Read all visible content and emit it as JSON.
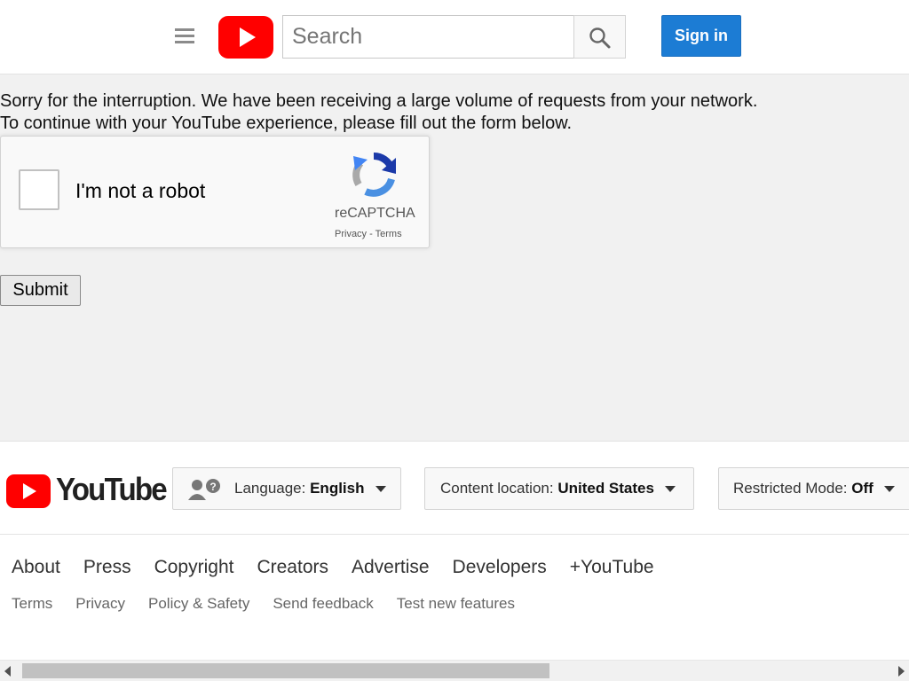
{
  "header": {
    "search_placeholder": "Search",
    "sign_in_label": "Sign in",
    "brand_color": "#ff0000",
    "accent_color": "#1c7cd4"
  },
  "message": {
    "line1": "Sorry for the interruption. We have been receiving a large volume of requests from your network.",
    "line2": "To continue with your YouTube experience, please fill out the form below."
  },
  "recaptcha": {
    "label": "I'm not a robot",
    "brand": "reCAPTCHA",
    "privacy": "Privacy",
    "separator": " - ",
    "terms": "Terms"
  },
  "form": {
    "submit_label": "Submit"
  },
  "footer": {
    "logo_text": "YouTube",
    "language": {
      "label": "Language: ",
      "value": "English"
    },
    "location": {
      "label": "Content location: ",
      "value": "United States"
    },
    "restricted": {
      "label": "Restricted Mode: ",
      "value": "Off"
    },
    "primary_links": [
      "About",
      "Press",
      "Copyright",
      "Creators",
      "Advertise",
      "Developers",
      "+YouTube"
    ],
    "secondary_links": [
      "Terms",
      "Privacy",
      "Policy & Safety",
      "Send feedback",
      "Test new features"
    ]
  },
  "scrollbar": {
    "horizontal_thumb_fraction": 0.61
  }
}
